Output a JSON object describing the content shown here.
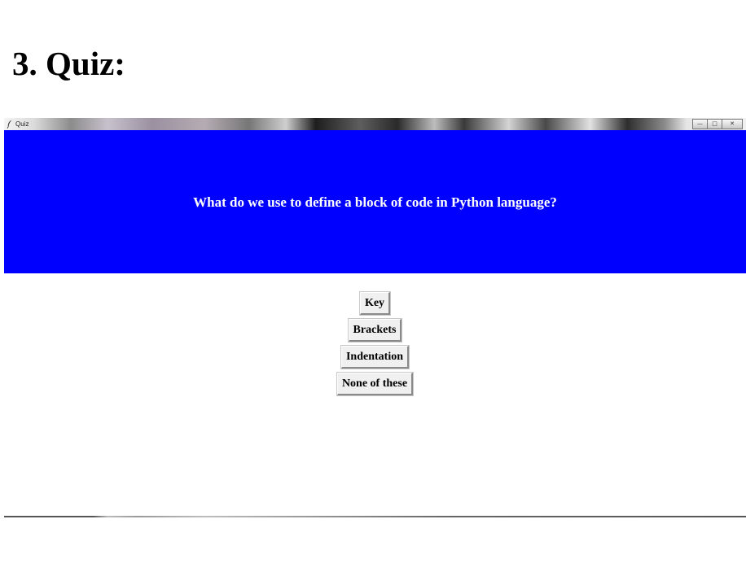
{
  "document": {
    "heading": "3. Quiz:"
  },
  "window": {
    "title": "Quiz",
    "controls": {
      "minimize_icon": "minimize-icon",
      "maximize_icon": "maximize-icon",
      "close_icon": "close-icon"
    }
  },
  "question": {
    "text": "What do we use to define a block of code in Python language?",
    "background_color": "#0000ff",
    "text_color": "#ffffff"
  },
  "answers": [
    {
      "label": "Key"
    },
    {
      "label": "Brackets"
    },
    {
      "label": "Indentation"
    },
    {
      "label": "None of these"
    }
  ]
}
